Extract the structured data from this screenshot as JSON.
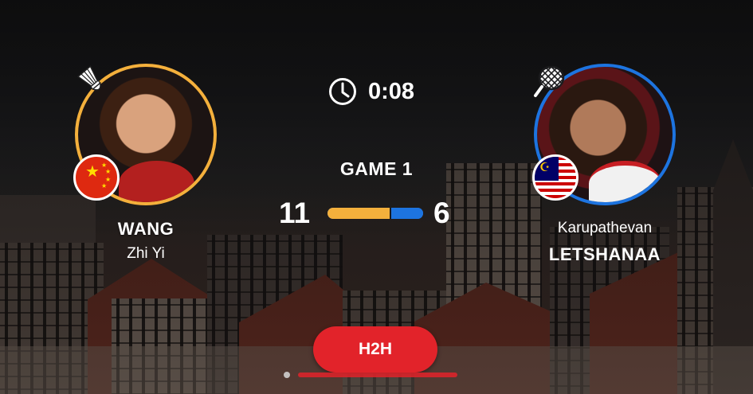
{
  "timer": {
    "icon": "clock-icon",
    "text": "0:08"
  },
  "match": {
    "game_label": "GAME 1"
  },
  "players": {
    "left": {
      "name_primary": "WANG",
      "name_secondary": "Zhi Yi",
      "flag": "china-flag",
      "status_icon": "shuttlecock-icon",
      "score": "11",
      "color": "#f4b03c"
    },
    "right": {
      "name_primary": "Karupathevan",
      "name_secondary": "LETSHANAA",
      "flag": "malaysia-flag",
      "status_icon": "racket-icon",
      "score": "6",
      "color": "#1d74e0"
    }
  },
  "score_bar": {
    "left_share": 0.647,
    "right_share": 0.353
  },
  "actions": {
    "h2h_label": "H2H",
    "h2h_color": "#e2232a"
  }
}
